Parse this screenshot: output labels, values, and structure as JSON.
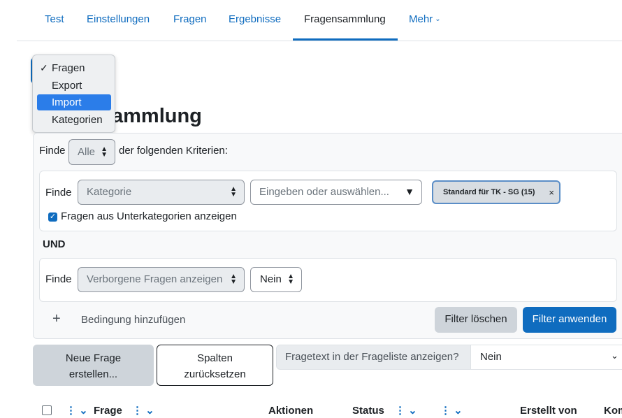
{
  "tabs": [
    {
      "label": "Test"
    },
    {
      "label": "Einstellungen"
    },
    {
      "label": "Fragen"
    },
    {
      "label": "Ergebnisse"
    },
    {
      "label": "Fragensammlung"
    },
    {
      "label": "Mehr"
    }
  ],
  "page_title": "ammlung",
  "dropdown": {
    "items": [
      {
        "label": "Fragen",
        "checked": true
      },
      {
        "label": "Export"
      },
      {
        "label": "Import",
        "highlighted": true
      },
      {
        "label": "Kategorien"
      }
    ]
  },
  "filter": {
    "finde_label": "Finde",
    "match_select": "Alle",
    "criteria_text": "der folgenden Kriterien:",
    "condition1": {
      "label": "Finde",
      "type_select": "Kategorie",
      "search_placeholder": "Eingeben oder auswählen...",
      "selected_tag": "Standard für TK - SG (15)",
      "subcat_checkbox_label": "Fragen aus Unterkategorien anzeigen"
    },
    "joiner": "UND",
    "condition2": {
      "label": "Finde",
      "type_select": "Verborgene Fragen anzeigen",
      "value_select": "Nein"
    },
    "add_condition_icon": "+",
    "add_condition_label": "Bedingung hinzufügen",
    "clear_button": "Filter löschen",
    "apply_button": "Filter anwenden"
  },
  "actions": {
    "new_question_line1": "Neue Frage",
    "new_question_line2": "erstellen...",
    "reset_columns_line1": "Spalten",
    "reset_columns_line2": "zurücksetzen",
    "show_text_label": "Fragetext in der Frageliste anzeigen?",
    "show_text_value": "Nein"
  },
  "table": {
    "columns": [
      "Frage",
      "Aktionen",
      "Status",
      "Erstellt von",
      "Kom"
    ]
  },
  "colors": {
    "link": "#0f6cbf",
    "primary": "#0f6cbf",
    "highlight": "#2b7de9"
  }
}
